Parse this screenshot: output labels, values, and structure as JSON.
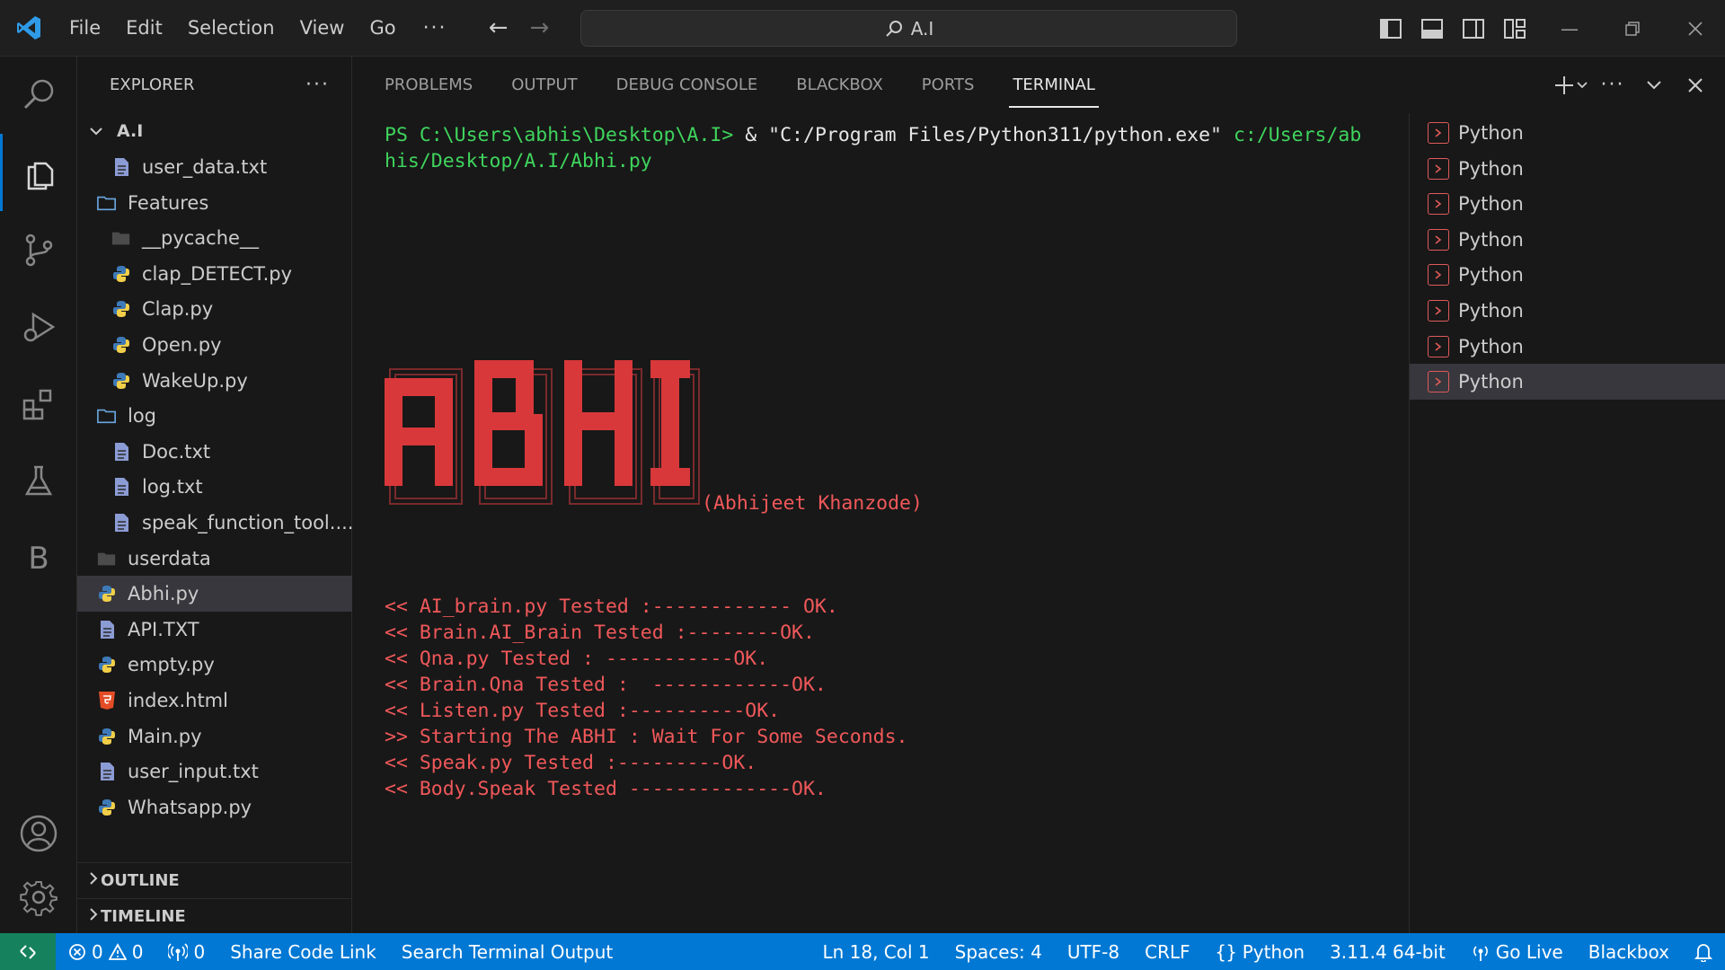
{
  "menu": [
    "File",
    "Edit",
    "Selection",
    "View",
    "Go"
  ],
  "menu_more": "···",
  "search": {
    "text": "A.I"
  },
  "explorer": {
    "title": "EXPLORER",
    "more": "···",
    "root": "A.I",
    "items": [
      {
        "label": "user_data.txt",
        "type": "txt",
        "indent": 2
      },
      {
        "label": "Features",
        "type": "folder-open",
        "indent": 1
      },
      {
        "label": "__pycache__",
        "type": "folder-closed",
        "indent": 2
      },
      {
        "label": "clap_DETECT.py",
        "type": "py",
        "indent": 2
      },
      {
        "label": "Clap.py",
        "type": "py",
        "indent": 2
      },
      {
        "label": "Open.py",
        "type": "py",
        "indent": 2
      },
      {
        "label": "WakeUp.py",
        "type": "py",
        "indent": 2
      },
      {
        "label": "log",
        "type": "folder-open",
        "indent": 1
      },
      {
        "label": "Doc.txt",
        "type": "txt",
        "indent": 2
      },
      {
        "label": "log.txt",
        "type": "txt",
        "indent": 2
      },
      {
        "label": "speak_function_tool....",
        "type": "txt",
        "indent": 2
      },
      {
        "label": "userdata",
        "type": "folder-closed",
        "indent": 1
      },
      {
        "label": "Abhi.py",
        "type": "py",
        "indent": 1,
        "selected": true
      },
      {
        "label": "API.TXT",
        "type": "txt",
        "indent": 1
      },
      {
        "label": "empty.py",
        "type": "py",
        "indent": 1
      },
      {
        "label": "index.html",
        "type": "html",
        "indent": 1
      },
      {
        "label": "Main.py",
        "type": "py",
        "indent": 1
      },
      {
        "label": "user_input.txt",
        "type": "txt",
        "indent": 1
      },
      {
        "label": "Whatsapp.py",
        "type": "py",
        "indent": 1
      }
    ],
    "sections": [
      "OUTLINE",
      "TIMELINE"
    ]
  },
  "activity": {
    "b_letter": "B"
  },
  "panel": {
    "tabs": [
      "PROBLEMS",
      "OUTPUT",
      "DEBUG CONSOLE",
      "BLACKBOX",
      "PORTS",
      "TERMINAL"
    ],
    "active_tab": "TERMINAL"
  },
  "terminal": {
    "prompt": "PS C:\\Users\\abhis\\Desktop\\A.I> ",
    "amp": "& ",
    "exe": "\"C:/Program Files/Python311/python.exe\" ",
    "arg_line1": "c:/Users/ab",
    "arg_line2": "his/Desktop/A.I/Abhi.py",
    "banner": "ABHI",
    "author": "(Abhijeet Khanzode)",
    "log": [
      "<< AI_brain.py Tested :------------ OK.",
      "<< Brain.AI_Brain Tested :--------OK.",
      "<< Qna.py Tested : -----------OK.",
      "<< Brain.Qna Tested :  ------------OK.",
      "<< Listen.py Tested :----------OK.",
      ">> Starting The ABHI : Wait For Some Seconds.",
      "<< Speak.py Tested :---------OK.",
      "<< Body.Speak Tested --------------OK."
    ]
  },
  "terminal_list": [
    "Python",
    "Python",
    "Python",
    "Python",
    "Python",
    "Python",
    "Python",
    "Python"
  ],
  "status": {
    "errors": "0",
    "warnings": "0",
    "ports": "0",
    "share": "Share Code Link",
    "search_term": "Search Terminal Output",
    "position": "Ln 18, Col 1",
    "spaces": "Spaces: 4",
    "encoding": "UTF-8",
    "eol": "CRLF",
    "language": "Python",
    "interpreter": "3.11.4 64-bit",
    "golive": "Go Live",
    "blackbox": "Blackbox"
  },
  "colors": {
    "accent": "#0078d4",
    "terminal_green": "#3fd45d",
    "terminal_red": "#f0585a",
    "banner_red": "#d9383a"
  }
}
